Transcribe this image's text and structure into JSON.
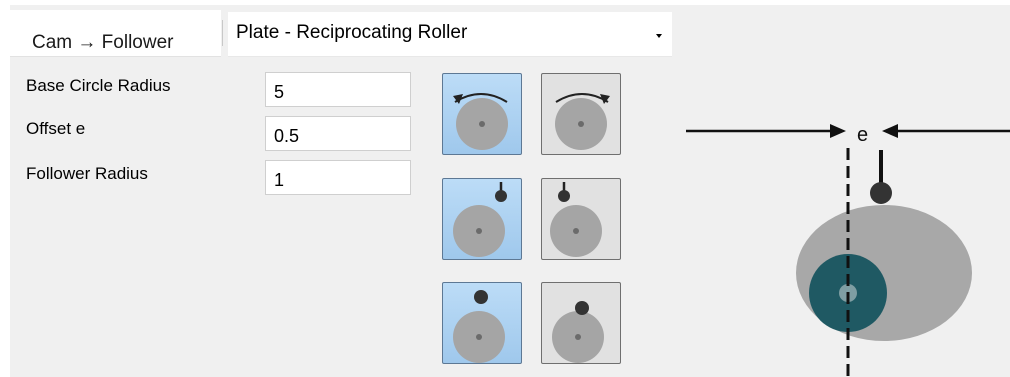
{
  "tab": {
    "label": "Cam → Follower"
  },
  "dropdown": {
    "selected": "Plate - Reciprocating Roller"
  },
  "fields": {
    "base_circle_radius": {
      "label": "Base Circle Radius",
      "value": "5"
    },
    "offset_e": {
      "label": "Offset e",
      "value": "0.5"
    },
    "follower_radius": {
      "label": "Follower Radius",
      "value": "1"
    }
  },
  "option_buttons": {
    "rotation_ccw": {
      "selected": true
    },
    "rotation_cw": {
      "selected": false
    },
    "offset_right": {
      "selected": true
    },
    "offset_left": {
      "selected": false
    },
    "follower_centered_above": {
      "selected": true
    },
    "follower_centered_lower": {
      "selected": false
    }
  },
  "diagram": {
    "offset_label": "e",
    "colors": {
      "cam": "#a8a8a8",
      "follower": "#1f5963",
      "line": "#111111"
    }
  }
}
